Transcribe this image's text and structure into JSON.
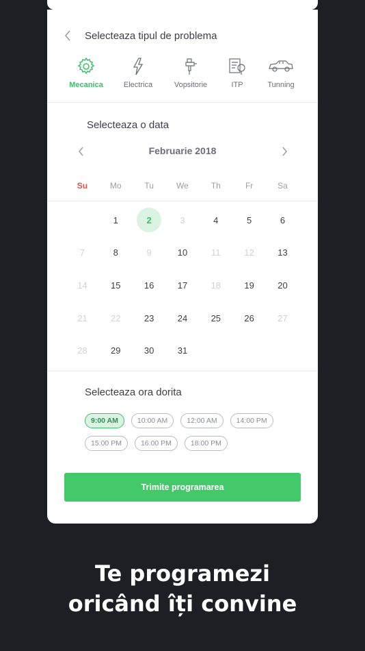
{
  "problem": {
    "title": "Selecteaza tipul de problema",
    "types": [
      {
        "label": "Mecanica",
        "icon": "gear-icon",
        "active": true
      },
      {
        "label": "Electrica",
        "icon": "lightning-icon",
        "active": false
      },
      {
        "label": "Vopsitorie",
        "icon": "spray-gun-icon",
        "active": false
      },
      {
        "label": "ITP",
        "icon": "inspection-icon",
        "active": false
      },
      {
        "label": "Tunning",
        "icon": "car-icon",
        "active": false
      }
    ]
  },
  "calendar": {
    "title": "Selecteaza o data",
    "month": "Februarie 2018",
    "weekdays": [
      "Su",
      "Mo",
      "Tu",
      "We",
      "Th",
      "Fr",
      "Sa"
    ],
    "selected_day": "2",
    "weeks": [
      [
        null,
        {
          "d": "1"
        },
        {
          "d": "2",
          "sel": true
        },
        {
          "d": "3",
          "dim": true
        },
        {
          "d": "4"
        },
        {
          "d": "5"
        },
        {
          "d": "6"
        }
      ],
      [
        {
          "d": "7",
          "dim": true
        },
        {
          "d": "8"
        },
        {
          "d": "9",
          "dim": true
        },
        {
          "d": "10"
        },
        {
          "d": "11",
          "dim": true
        },
        {
          "d": "12",
          "dim": true
        },
        {
          "d": "13"
        }
      ],
      [
        {
          "d": "14",
          "dim": true
        },
        {
          "d": "15"
        },
        {
          "d": "16"
        },
        {
          "d": "17"
        },
        {
          "d": "18",
          "dim": true
        },
        {
          "d": "19"
        },
        {
          "d": "20"
        }
      ],
      [
        {
          "d": "21",
          "dim": true
        },
        {
          "d": "22",
          "dim": true
        },
        {
          "d": "23"
        },
        {
          "d": "24"
        },
        {
          "d": "25"
        },
        {
          "d": "26"
        },
        {
          "d": "27",
          "dim": true
        }
      ],
      [
        {
          "d": "28",
          "dim": true
        },
        {
          "d": "29"
        },
        {
          "d": "30"
        },
        {
          "d": "31"
        },
        null,
        null,
        null
      ]
    ]
  },
  "time": {
    "title": "Selecteaza ora dorita",
    "slots": [
      [
        {
          "label": "9:00 AM",
          "active": true
        },
        {
          "label": "10:00 AM"
        },
        {
          "label": "12:00 AM"
        },
        {
          "label": "14:00 PM"
        }
      ],
      [
        {
          "label": "15:00 PM"
        },
        {
          "label": "16:00 PM"
        },
        {
          "label": "18:00 PM"
        }
      ]
    ]
  },
  "submit_label": "Trimite programarea",
  "tagline": {
    "line1": "Te programezi",
    "line2": "oricând îți convine"
  },
  "colors": {
    "accent": "#43c86a",
    "sunday": "#d9534f",
    "background": "#1e1f24"
  }
}
